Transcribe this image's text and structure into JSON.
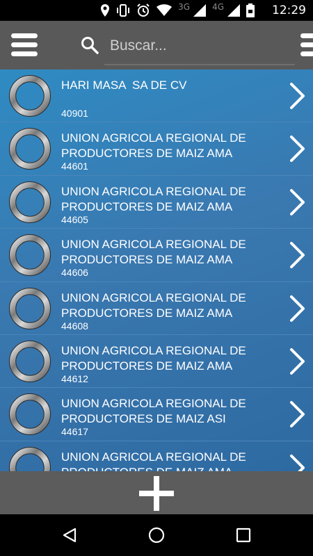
{
  "status_bar": {
    "time": "12:29",
    "network_1": "3G",
    "network_2": "4G"
  },
  "search": {
    "placeholder": "Buscar...",
    "value": ""
  },
  "items": [
    {
      "title": "HARI MASA  SA DE CV",
      "code": "40901"
    },
    {
      "title": "UNION AGRICOLA REGIONAL DE PRODUCTORES DE MAIZ AMA",
      "code": "44601"
    },
    {
      "title": "UNION AGRICOLA REGIONAL DE PRODUCTORES DE MAIZ AMA",
      "code": "44605"
    },
    {
      "title": "UNION AGRICOLA REGIONAL DE PRODUCTORES DE MAIZ AMA",
      "code": "44606"
    },
    {
      "title": "UNION AGRICOLA REGIONAL DE PRODUCTORES DE MAIZ AMA",
      "code": "44608"
    },
    {
      "title": "UNION AGRICOLA REGIONAL DE PRODUCTORES DE MAIZ AMA",
      "code": "44612"
    },
    {
      "title": "UNION AGRICOLA REGIONAL DE PRODUCTORES DE MAIZ ASI",
      "code": "44617"
    },
    {
      "title": "UNION AGRICOLA REGIONAL DE PRODUCTORES DE MAIZ AMA",
      "code": ""
    }
  ],
  "icons": {
    "menu": "hamburger-icon",
    "search": "search-icon",
    "item_avatar": "ring-icon",
    "item_action": "chevron-right-icon",
    "add": "plus-icon",
    "nav_back": "back-triangle-icon",
    "nav_home": "home-circle-icon",
    "nav_recents": "recents-square-icon"
  },
  "colors": {
    "app_bar": "#595959",
    "list_background": "#3a78b0",
    "bottom_bar": "#5c5c5c"
  }
}
